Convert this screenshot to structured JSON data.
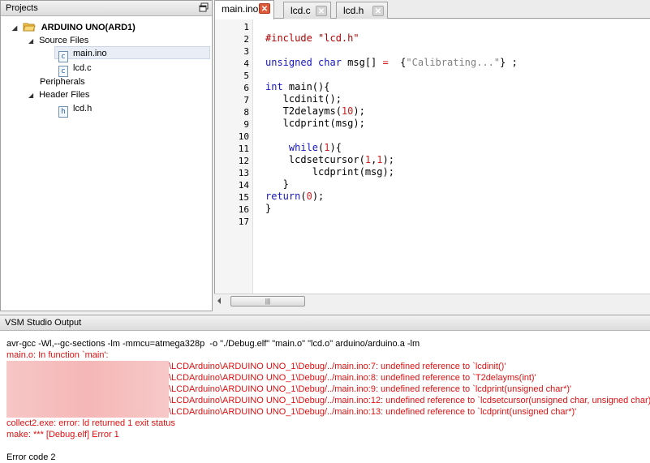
{
  "projects_panel": {
    "title": "Projects",
    "tree": {
      "root": "ARDUINO UNO(ARD1)",
      "source_files_label": "Source Files",
      "source_files": [
        "main.ino",
        "lcd.c"
      ],
      "peripherals_label": "Peripherals",
      "header_files_label": "Header Files",
      "header_files": [
        "lcd.h"
      ]
    }
  },
  "editor": {
    "tabs": [
      {
        "label": "main.ino",
        "active": true
      },
      {
        "label": "lcd.c",
        "active": false
      },
      {
        "label": "lcd.h",
        "active": false
      }
    ],
    "line_numbers": [
      "1",
      "2",
      "3",
      "4",
      "5",
      "6",
      "7",
      "8",
      "9",
      "10",
      "11",
      "12",
      "13",
      "14",
      "15",
      "16",
      "17"
    ],
    "code": {
      "l2_a": "#include ",
      "l2_b": "\"lcd.h\"",
      "l4_a": "unsigned char",
      "l4_b": " msg[] ",
      "l4_c": "=",
      "l4_d": "  {",
      "l4_e": "\"Calibrating...\"",
      "l4_f": "} ;",
      "l6_a": "int",
      "l6_b": " main(){",
      "l7": "   lcdinit();",
      "l8_a": "   T2delayms(",
      "l8_b": "10",
      "l8_c": ");",
      "l9": "   lcdprint(msg);",
      "l11_a": "    while",
      "l11_b": "(",
      "l11_c": "1",
      "l11_d": "){",
      "l12_a": "    lcdsetcursor(",
      "l12_b": "1",
      "l12_c": ",",
      "l12_d": "1",
      "l12_e": ");",
      "l13": "        lcdprint(msg);",
      "l14": "   }",
      "l15_a": "return",
      "l15_b": "(",
      "l15_c": "0",
      "l15_d": ");",
      "l16": "}"
    }
  },
  "output_panel": {
    "title": "VSM Studio Output",
    "lines": [
      "avr-gcc -Wl,--gc-sections -lm -mmcu=atmega328p  -o \"./Debug.elf\" \"main.o\" \"lcd.o\" arduino/arduino.a -lm",
      "main.o: In function `main':",
      "\\LCDArduino\\ARDUINO UNO_1\\Debug/../main.ino:7: undefined reference to `lcdinit()'",
      "\\LCDArduino\\ARDUINO UNO_1\\Debug/../main.ino:8: undefined reference to `T2delayms(int)'",
      "\\LCDArduino\\ARDUINO UNO_1\\Debug/../main.ino:9: undefined reference to `lcdprint(unsigned char*)'",
      "\\LCDArduino\\ARDUINO UNO_1\\Debug/../main.ino:12: undefined reference to `lcdsetcursor(unsigned char, unsigned char)'",
      "\\LCDArduino\\ARDUINO UNO_1\\Debug/../main.ino:13: undefined reference to `lcdprint(unsigned char*)'",
      "collect2.exe: error: ld returned 1 exit status",
      "make: *** [Debug.elf] Error 1",
      "Error code 2"
    ]
  },
  "colors": {
    "error_text": "#e01010",
    "keyword": "#1515c0",
    "preprocessor": "#b00000",
    "tab_close_active": "#e05a3a"
  }
}
